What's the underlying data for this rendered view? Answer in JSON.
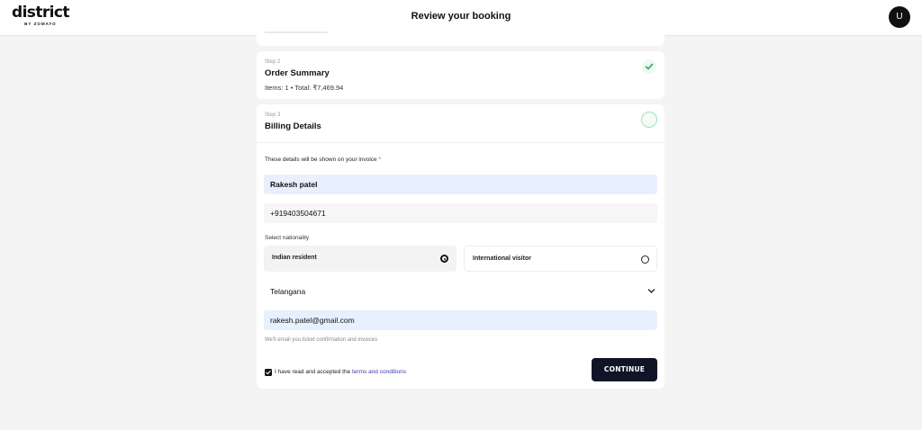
{
  "header": {
    "logo_main": "district",
    "logo_sub": "BY ZOMATO",
    "title": "Review your booking",
    "avatar_initial": "U"
  },
  "order_summary": {
    "step_label": "Step 2",
    "title": "Order Summary",
    "meta": "Items: 1 • Total: ₹7,469.94",
    "status_icon": "check-icon"
  },
  "billing": {
    "step_label": "Step 3",
    "title": "Billing Details",
    "status_icon": "pending-circle-icon",
    "invoice_note": "These details will be shown on your invoice",
    "required_mark": "*",
    "name_value": "Rakesh patel",
    "phone_value": "+919403504671",
    "nationality_label": "Select nationality",
    "nationality_options": [
      {
        "label": "Indian resident",
        "selected": true
      },
      {
        "label": "International visitor",
        "selected": false
      }
    ],
    "state_value": "Telangana",
    "email_value": "rakesh.patel@gmail.com",
    "email_note": "We'll email you ticket confirmation and invoices",
    "terms_prefix": "I have read and accepted the",
    "terms_link": "terms and conditions",
    "terms_checked": true,
    "continue_label": "CONTINUE"
  },
  "colors": {
    "page_bg": "#f4f4f5",
    "continue_bg": "#0f1527",
    "autofill_bg": "#e8f0fe",
    "link": "#3b3bb3",
    "success_green": "#2fa35a"
  }
}
